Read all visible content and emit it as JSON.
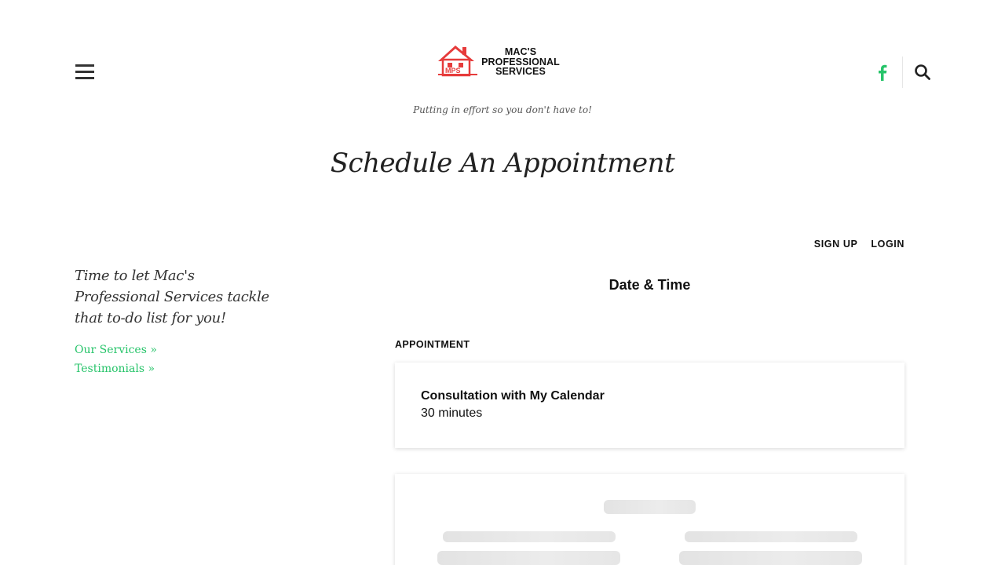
{
  "header": {
    "logo_line1": "MAC'S",
    "logo_line2": "PROFESSIONAL",
    "logo_line3": "SERVICES",
    "logo_badge": "MPS",
    "tagline": "Putting in effort so you don't have to!",
    "facebook_color": "#27c46a"
  },
  "page": {
    "title": "Schedule An Appointment"
  },
  "sidebar": {
    "intro": "Time to let Mac's Professional Services tackle that to-do list for you!",
    "links": [
      {
        "label": "Our Services »"
      },
      {
        "label": "Testimonials »"
      }
    ],
    "link_color": "#27c46a"
  },
  "scheduler": {
    "sign_up": "SIGN UP",
    "login": "LOGIN",
    "heading": "Date & Time",
    "appointment_label": "APPOINTMENT",
    "appointment": {
      "name": "Consultation with My Calendar",
      "duration": "30 minutes"
    },
    "calendar_state": "loading"
  },
  "icons": {
    "menu": "hamburger-menu-icon",
    "facebook": "facebook-icon",
    "search": "search-icon",
    "logo": "house-logo-icon"
  }
}
